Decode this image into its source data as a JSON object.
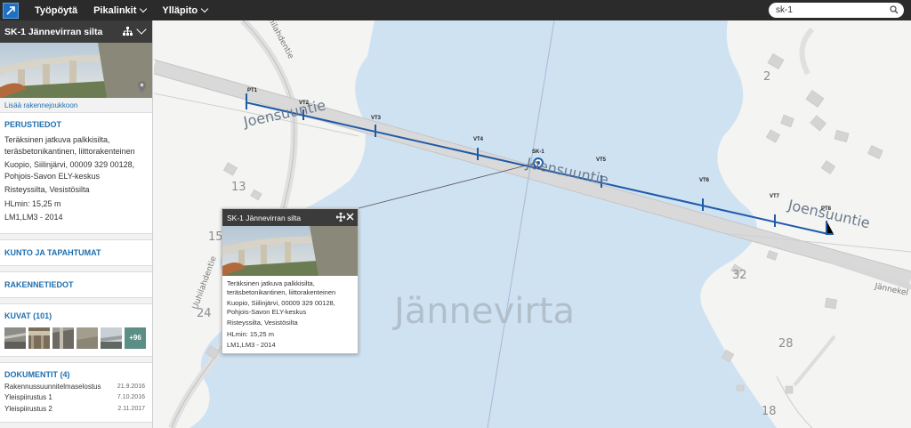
{
  "topbar": {
    "logo_icon": "app-logo-icon",
    "nav": [
      {
        "label": "Työpöytä",
        "dropdown": false
      },
      {
        "label": "Pikalinkit",
        "dropdown": true
      },
      {
        "label": "Ylläpito",
        "dropdown": true
      }
    ],
    "search_value": "sk-1"
  },
  "sidebar": {
    "title": "SK-1 Jännevirran silta",
    "add_link": "Lisää rakennejoukkoon",
    "basic": {
      "title": "PERUSTIEDOT",
      "lines": [
        "Teräksinen jatkuva palkkisilta, teräsbetonikantinen, liittorakenteinen",
        "Kuopio, Siilinjärvi, 00009 329 00128, Pohjois-Savon ELY-keskus",
        "Risteyssilta, Vesistösilta",
        "HLmin: 15,25 m",
        "LM1,LM3 - 2014"
      ]
    },
    "condition": "KUNTO JA TAPAHTUMAT",
    "structure": "RAKENNETIEDOT",
    "images": {
      "title": "KUVAT (101)",
      "more": "+96"
    },
    "documents": {
      "title": "DOKUMENTIT (4)",
      "rows": [
        {
          "name": "Rakennussuunnitelmaselostus",
          "date": "21.9.2016"
        },
        {
          "name": "Yleispiirustus 1",
          "date": "7.10.2016"
        },
        {
          "name": "Yleispiirustus 2",
          "date": "2.11.2017"
        }
      ]
    }
  },
  "map": {
    "lake_label": "Jännevirta",
    "road_labels": [
      "Joensuuntie",
      "Joensuuntie",
      "Joensuuntie"
    ],
    "street_labels": [
      "Uuhilahdentie",
      "Uuhilahdentie",
      "Jännekel"
    ],
    "house_numbers": [
      "2",
      "13",
      "15",
      "24",
      "32",
      "28",
      "18"
    ],
    "points": [
      "PT1",
      "VT2",
      "VT3",
      "VT4",
      "SK-1",
      "VT5",
      "VT6",
      "VT7",
      "PT8"
    ],
    "colors": {
      "water": "#cfe2f2",
      "land": "#f4f4f2",
      "road": "#d9d9d9",
      "bridge": "#1f5aa8"
    }
  },
  "popup": {
    "title": "SK-1 Jännevirran silta",
    "lines": [
      "Teräksinen jatkuva palkkisilta, teräsbetonikantinen, liittorakenteinen",
      "Kuopio, Siilinjärvi, 00009 329 00128, Pohjois-Savon ELY-keskus",
      "Risteyssilta, Vesistösilta",
      "HLmin: 15,25 m",
      "LM1,LM3 - 2014"
    ]
  }
}
